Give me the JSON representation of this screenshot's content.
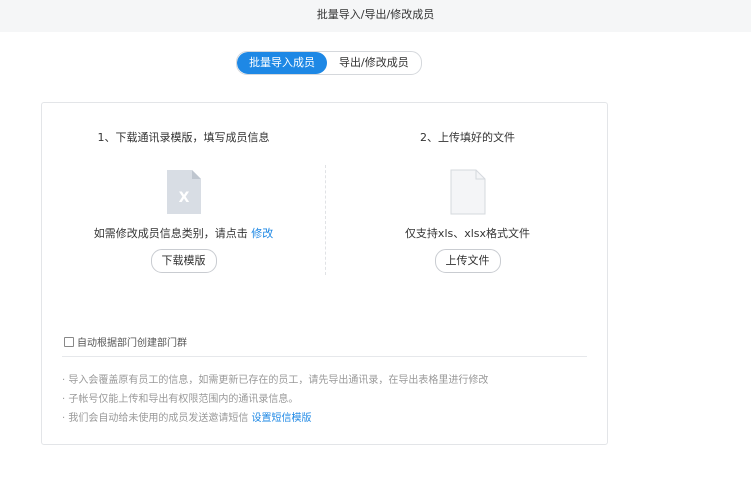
{
  "header": {
    "title": "批量导入/导出/修改成员"
  },
  "tabs": [
    {
      "label": "批量导入成员",
      "active": true
    },
    {
      "label": "导出/修改成员",
      "active": false
    }
  ],
  "steps": {
    "left": {
      "title": "1、下载通讯录模版，填写成员信息",
      "icon_letter": "X",
      "desc_text": "如需修改成员信息类别，请点击",
      "desc_link": "修改",
      "button": "下载模版"
    },
    "right": {
      "title": "2、上传填好的文件",
      "desc_text": "仅支持xls、xlsx格式文件",
      "button": "上传文件"
    }
  },
  "option": {
    "checkbox_label": "自动根据部门创建部门群",
    "checked": false
  },
  "notes": [
    "· 导入会覆盖原有员工的信息，如需更新已存在的员工，请先导出通讯录，在导出表格里进行修改",
    "· 子帐号仅能上传和导出有权限范围内的通讯录信息。",
    "· 我们会自动给未使用的成员发送邀请短信"
  ],
  "notes_link": "设置短信模版",
  "colors": {
    "accent": "#1e88e5",
    "icon_gray": "#d8dde4",
    "muted_text": "#999999"
  }
}
